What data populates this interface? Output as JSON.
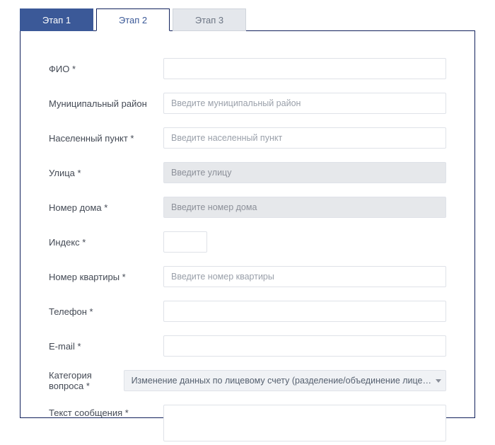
{
  "tabs": [
    {
      "label": "Этап 1"
    },
    {
      "label": "Этап 2"
    },
    {
      "label": "Этап 3"
    }
  ],
  "form": {
    "fio": {
      "label": "ФИО *",
      "placeholder": ""
    },
    "district": {
      "label": "Муниципальный район",
      "placeholder": "Введите муниципальный район"
    },
    "city": {
      "label": "Населенный пункт *",
      "placeholder": "Введите населенный пункт"
    },
    "street": {
      "label": "Улица *",
      "placeholder": "Введите улицу"
    },
    "house": {
      "label": "Номер дома *",
      "placeholder": "Введите номер дома"
    },
    "zip": {
      "label": "Индекс *",
      "placeholder": ""
    },
    "apt": {
      "label": "Номер квартиры *",
      "placeholder": "Введите номер квартиры"
    },
    "phone": {
      "label": "Телефон *",
      "placeholder": ""
    },
    "email": {
      "label": "E-mail *",
      "placeholder": ""
    },
    "category": {
      "label": "Категория вопроса *",
      "selected": "Изменение данных по лицевому счету (разделение/объединение лице…"
    },
    "message": {
      "label": "Текст сообщения *",
      "placeholder": ""
    }
  }
}
